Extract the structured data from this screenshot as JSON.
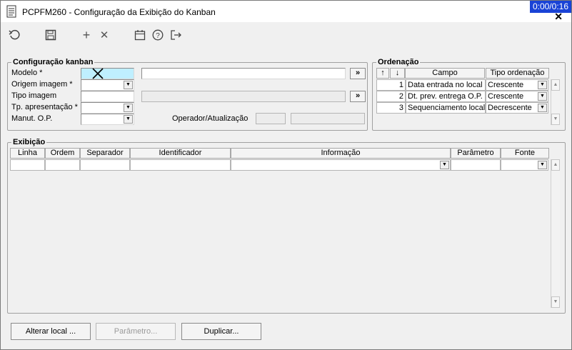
{
  "window": {
    "title": "PCPFM260 - Configuração da Exibição do Kanban",
    "timer": "0:00/0:16"
  },
  "toolbar_icons": [
    "undo-icon",
    "save-icon",
    "add-icon",
    "delete-icon",
    "calendar-icon",
    "help-icon",
    "exit-icon"
  ],
  "config": {
    "legend": "Configuração kanban",
    "modelo_label": "Modelo *",
    "origem_label": "Origem imagem *",
    "tipo_label": "Tipo imagem",
    "tp_apresentacao_label": "Tp. apresentação *",
    "manut_label": "Manut. O.P.",
    "operador_label": "Operador/Atualização",
    "browse_label": "»"
  },
  "ordenacao": {
    "legend": "Ordenação",
    "up_arrow": "↑",
    "down_arrow": "↓",
    "columns": [
      "Campo",
      "Tipo ordenação"
    ],
    "rows": [
      {
        "num": "1",
        "campo": "Data entrada no local",
        "tipo": "Crescente"
      },
      {
        "num": "2",
        "campo": "Dt. prev. entrega O.P.",
        "tipo": "Crescente"
      },
      {
        "num": "3",
        "campo": "Sequenciamento local",
        "tipo": "Decrescente"
      }
    ]
  },
  "exibicao": {
    "legend": "Exibição",
    "columns": [
      "Linha",
      "Ordem",
      "Separador",
      "Identificador",
      "Informação",
      "Parâmetro",
      "Fonte"
    ]
  },
  "buttons": {
    "alterar_local": "Alterar local ...",
    "parametro": "Parâmetro...",
    "duplicar": "Duplicar..."
  }
}
